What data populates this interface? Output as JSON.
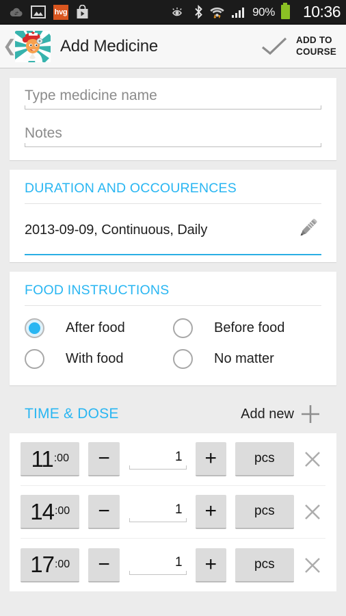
{
  "statusbar": {
    "icons_left": [
      "cloud-sync-icon",
      "gallery-icon",
      "hvg-icon",
      "play-store-icon"
    ],
    "hvg_label": "hvg",
    "icons_right": [
      "eye-icon",
      "bluetooth-icon",
      "wifi-icon",
      "signal-icon"
    ],
    "battery_percent": "90%",
    "clock": "10:36"
  },
  "actionbar": {
    "back_icon": "back-chevron-icon",
    "logo": "nurse-app-logo",
    "title": "Add Medicine",
    "check_icon": "checkmark-icon",
    "action_label_line1": "ADD TO",
    "action_label_line2": "COURSE"
  },
  "form": {
    "name_placeholder": "Type medicine name",
    "name_value": "",
    "notes_placeholder": "Notes",
    "notes_value": ""
  },
  "duration": {
    "section_title": "DURATION AND OCCOURENCES",
    "value": "2013-09-09, Continuous, Daily",
    "edit_icon": "pencil-icon"
  },
  "food": {
    "section_title": "FOOD INSTRUCTIONS",
    "options": [
      {
        "label": "After food",
        "selected": true
      },
      {
        "label": "Before food",
        "selected": false
      },
      {
        "label": "With food",
        "selected": false
      },
      {
        "label": "No matter",
        "selected": false
      }
    ]
  },
  "timedose": {
    "section_title": "TIME & DOSE",
    "add_new_label": "Add new",
    "add_icon": "plus-icon",
    "decrement_label": "−",
    "increment_label": "+",
    "delete_icon": "close-icon",
    "rows": [
      {
        "hour": "11",
        "minute": ":00",
        "quantity": "1",
        "unit": "pcs"
      },
      {
        "hour": "14",
        "minute": ":00",
        "quantity": "1",
        "unit": "pcs"
      },
      {
        "hour": "17",
        "minute": ":00",
        "quantity": "1",
        "unit": "pcs"
      }
    ]
  },
  "colors": {
    "accent": "#29b6f2",
    "background": "#ececec",
    "statusbar": "#1b1b1b",
    "battery": "#8bc024",
    "hvg": "#d9561f"
  }
}
